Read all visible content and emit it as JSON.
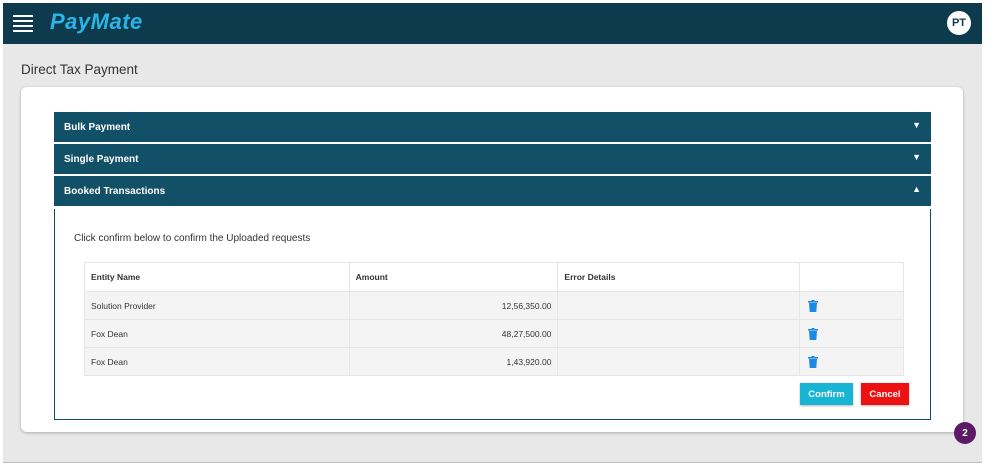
{
  "app": {
    "logo": "PayMate",
    "avatar_initials": "PT"
  },
  "page": {
    "title": "Direct Tax Payment"
  },
  "accordion": {
    "bulk_payment": "Bulk Payment",
    "single_payment": "Single Payment",
    "booked_transactions": "Booked Transactions"
  },
  "booked": {
    "instruction": "Click confirm below to confirm the Uploaded requests",
    "columns": [
      "Entity Name",
      "Amount",
      "Error Details",
      ""
    ],
    "rows": [
      {
        "entity": "Solution Provider",
        "amount": "12,56,350.00",
        "error": ""
      },
      {
        "entity": "Fox Dean",
        "amount": "48,27,500.00",
        "error": ""
      },
      {
        "entity": "Fox Dean",
        "amount": "1,43,920.00",
        "error": ""
      }
    ],
    "confirm_label": "Confirm",
    "cancel_label": "Cancel"
  },
  "notification": {
    "count": "2"
  },
  "colors": {
    "topbar": "#0d3b4d",
    "accordion": "#125068",
    "confirm": "#18b4d4",
    "cancel": "#ee1111",
    "badge": "#5b1a63",
    "logo": "#2bb5e6"
  },
  "icons": [
    "hamburger-menu-icon",
    "chevron-down-icon",
    "chevron-up-icon",
    "trash-icon"
  ]
}
